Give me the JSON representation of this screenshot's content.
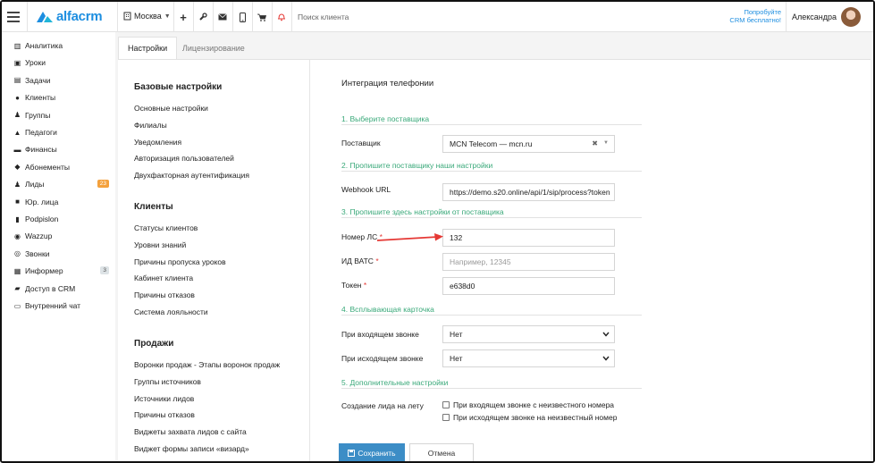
{
  "topbar": {
    "logo_text": "alfacrm",
    "city": "Москва",
    "search_placeholder": "Поиск клиента",
    "promo_line1": "Попробуйте",
    "promo_line2": "CRM бесплатно!",
    "user_name": "Александра"
  },
  "sidebar": {
    "items": [
      {
        "label": "Аналитика",
        "icon": "chart-icon"
      },
      {
        "label": "Уроки",
        "icon": "calendar-icon"
      },
      {
        "label": "Задачи",
        "icon": "tasks-icon"
      },
      {
        "label": "Клиенты",
        "icon": "user-icon"
      },
      {
        "label": "Группы",
        "icon": "users-icon"
      },
      {
        "label": "Педагоги",
        "icon": "graduation-cap-icon"
      },
      {
        "label": "Финансы",
        "icon": "money-icon"
      },
      {
        "label": "Абонементы",
        "icon": "tag-icon"
      },
      {
        "label": "Лиды",
        "icon": "users-icon",
        "badge": "23"
      },
      {
        "label": "Юр. лица",
        "icon": "briefcase-icon"
      },
      {
        "label": "Podpislon",
        "icon": "file-icon"
      },
      {
        "label": "Wazzup",
        "icon": "whatsapp-icon"
      },
      {
        "label": "Звонки",
        "icon": "skype-icon"
      },
      {
        "label": "Информер",
        "icon": "inbox-icon",
        "badge": "3"
      },
      {
        "label": "Доступ в CRM",
        "icon": "lock-icon"
      },
      {
        "label": "Внутренний чат",
        "icon": "chat-icon"
      }
    ]
  },
  "tabs": [
    {
      "label": "Настройки"
    },
    {
      "label": "Лицензирование"
    }
  ],
  "leftnav": {
    "sections": [
      {
        "title": "Базовые настройки",
        "items": [
          "Основные настройки",
          "Филиалы",
          "Уведомления",
          "Авторизация пользователей",
          "Двухфакторная аутентификация"
        ]
      },
      {
        "title": "Клиенты",
        "items": [
          "Статусы клиентов",
          "Уровни знаний",
          "Причины пропуска уроков",
          "Кабинет клиента",
          "Причины отказов",
          "Система лояльности"
        ]
      },
      {
        "title": "Продажи",
        "items": [
          "Воронки продаж - Этапы воронок продаж",
          "Группы источников",
          "Источники лидов",
          "Причины отказов",
          "Виджеты захвата лидов с сайта",
          "Виджет формы записи «визард»"
        ]
      }
    ]
  },
  "form": {
    "title": "Интеграция телефонии",
    "sections": [
      "1. Выберите поставщика",
      "2. Пропишите поставщику наши настройки",
      "3. Пропишите здесь настройки от поставщика",
      "4. Всплывающая карточка",
      "5. Дополнительные настройки"
    ],
    "provider_label": "Поставщик",
    "provider_value": "MCN Telecom — mcn.ru",
    "webhook_label": "Webhook URL",
    "webhook_value": "https://demo.s20.online/api/1/sip/process?token",
    "ls_label": "Номер ЛС",
    "ls_value": "132",
    "vats_label": "ИД ВАТС",
    "vats_placeholder": "Например, 12345",
    "token_label": "Токен",
    "token_value": "e638d0",
    "incoming_label": "При входящем звонке",
    "incoming_value": "Нет",
    "outgoing_label": "При исходящем звонке",
    "outgoing_value": "Нет",
    "create_lead_label": "Создание лида на лету",
    "chk_incoming": "При входящем звонке с неизвестного номера",
    "chk_outgoing": "При исходящем звонке на неизвестный номер",
    "required_mark": "*",
    "save_label": "Сохранить",
    "cancel_label": "Отмена"
  },
  "colors": {
    "accent": "#3c8dc6",
    "section": "#3aa97a",
    "badge_orange": "#f4a13d",
    "arrow": "#e53935"
  }
}
